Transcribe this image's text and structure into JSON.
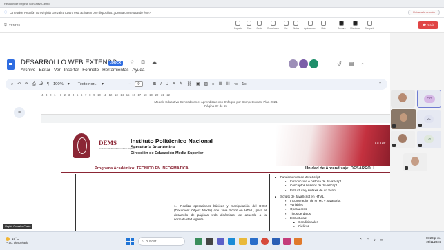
{
  "window": {
    "title": "Reunión de Virginia Gonzalez Castro",
    "notification": "La reunión Reunión con Virginia Gonzalez Castro está activa en otro dispositivo. ¿Desea unirse usando éste?",
    "notification_action": "Unirse a la reunión"
  },
  "meeting_toolbar": {
    "timer": "33:53:46",
    "items": [
      "Espacio",
      "Chat",
      "Gente",
      "Reacciones",
      "Ver",
      "Notas",
      "Aplicaciones",
      "Más",
      "Cámara",
      "Micrófono",
      "Compartir"
    ],
    "leave_label": "Salir"
  },
  "doc": {
    "title": "DESARROLLO WEB EXTENSO",
    "badge": ".DOCX",
    "title_icons": "☆ ⊡ ☁",
    "menu": [
      "Archivo",
      "Editar",
      "Ver",
      "Insertar",
      "Formato",
      "Herramientas",
      "Ayuda"
    ],
    "right_icons": [
      "↺",
      "▤",
      "◔"
    ]
  },
  "format_toolbar": {
    "zoom": "100%",
    "style": "Texto nor...",
    "font_size": "9",
    "bold": "B",
    "italic": "I",
    "underline": "U",
    "color": "A"
  },
  "ruler": {
    "text": "4 · 3 · 2 · 1 · · 1 · 2 · 3 · 4 · 5 · 6 · 7 · 8 · 9 · 10 · 11 · 12 · 13 · 14 · 15 · 16 · 17 · 18 · 19 · 20 · 21 · 22"
  },
  "prev_page": {
    "footer_line1": "Modelo Educativo Centrado en el Aprendizaje con Enfoque por Competencias, Plan 2021",
    "footer_line2": "Página 37 de 55"
  },
  "letterhead": {
    "dems_logo": "DEMS",
    "dems_sub": "Dirección de Educación Media Superior",
    "institution": "Instituto Politécnico Nacional",
    "secretaria": "Secretaría Académica",
    "direccion": "Dirección de Educación Media Superior",
    "banner_text": "La Téc",
    "program": "Programa Académico: TÉCNICO EN INFORMÁTICA",
    "unit": "Unidad de Aprendizaje: DESARROLL"
  },
  "content": {
    "competency": "1.- Realiza operaciones básicas y manipulación del DOM (Document Object Model) con Java Script en HTML, para el desarrollo de páginas web dinámicas, de acuerdo a la normatividad vigente.",
    "topics": [
      {
        "level": 1,
        "text": "Fundamentos de JavaScript"
      },
      {
        "level": 2,
        "text": "Introducción e historia de JavaScript"
      },
      {
        "level": 2,
        "text": "Conceptos básicos de JavaScript"
      },
      {
        "level": 2,
        "text": "Estructura y sintaxis de un Script"
      },
      {
        "level": 1,
        "text": "Scripts de JavaScript en HTML"
      },
      {
        "level": 2,
        "text": "Incorporación de HTML y Javascript"
      },
      {
        "level": 2,
        "text": "Variables"
      },
      {
        "level": 2,
        "text": "Operadores"
      },
      {
        "level": 2,
        "text": "Tipos de datos"
      },
      {
        "level": 2,
        "text": "Estructuras:"
      },
      {
        "level": 3,
        "text": "Condicionales"
      },
      {
        "level": 3,
        "text": "Ciclicas"
      }
    ]
  },
  "participants": {
    "cg": "CG",
    "vl": "VL",
    "lg": "LG"
  },
  "presenter_tag": "Virginia Gonzalez Castro",
  "taskbar": {
    "temp": "19°C",
    "weather": "Prac. despejado",
    "search": "Buscar",
    "time": "08:23 p. m.",
    "date": "25/11/2024"
  },
  "colors": {
    "ipn_guinda": "#8b2635",
    "docs_blue": "#2f6de1",
    "leave_red": "#e04545"
  }
}
